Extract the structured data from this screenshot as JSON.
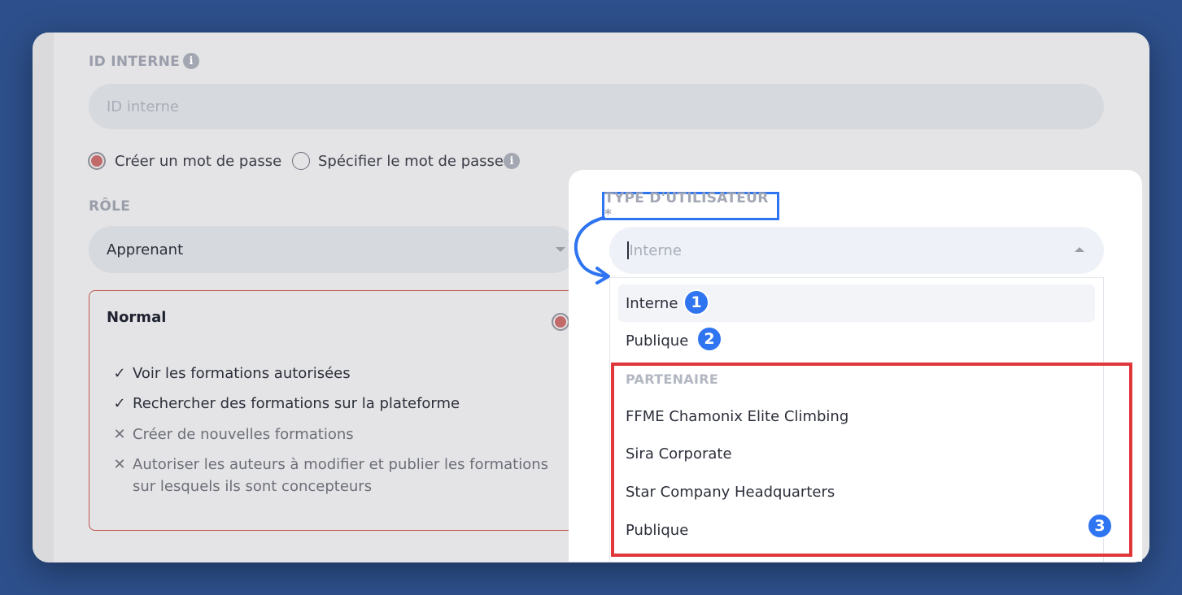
{
  "form": {
    "internal_id": {
      "label": "ID INTERNE",
      "placeholder": "ID interne",
      "info_icon": "info-icon"
    },
    "password": {
      "options": [
        {
          "label": "Créer un mot de passe",
          "selected": true
        },
        {
          "label": "Spécifier le mot de passe",
          "selected": false
        }
      ],
      "info_icon": "info-icon"
    },
    "role": {
      "label": "RÔLE",
      "value": "Apprenant",
      "card": {
        "title": "Normal",
        "selected": true,
        "permissions": [
          {
            "text": "Voir les formations autorisées",
            "allowed": true
          },
          {
            "text": "Rechercher des formations sur la plateforme",
            "allowed": true
          },
          {
            "text": "Créer de nouvelles formations",
            "allowed": false
          },
          {
            "text": "Autoriser les auteurs à modifier et publier les formations sur lesquels ils sont concepteurs",
            "allowed": false
          }
        ]
      }
    },
    "user_type": {
      "label": "TYPE D'UTILISATEUR *",
      "placeholder": "Interne",
      "options": [
        {
          "label": "Interne",
          "badge": "1",
          "highlighted": true
        },
        {
          "label": "Publique",
          "badge": "2",
          "highlighted": false
        }
      ],
      "group": {
        "label": "PARTENAIRE",
        "badge": "3",
        "items": [
          "FFME Chamonix Elite Climbing",
          "Sira Corporate",
          "Star Company Headquarters",
          "Publique"
        ]
      }
    }
  },
  "colors": {
    "background": "#2d4f8b",
    "accent": "#c06a6a",
    "annotation_blue": "#2f74f0",
    "annotation_red": "#e0373b"
  }
}
